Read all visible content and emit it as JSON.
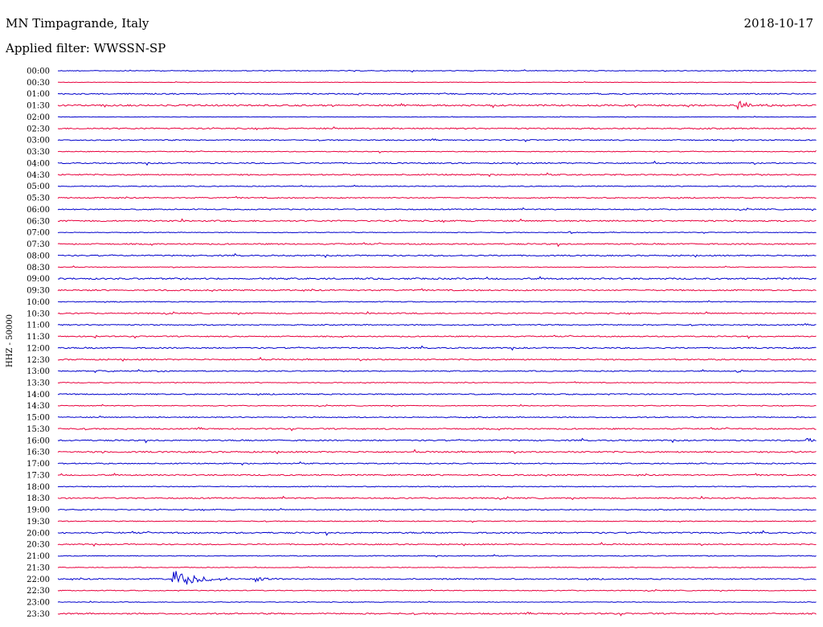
{
  "header": {
    "station": "MN Timpagrande, Italy",
    "date": "2018-10-17",
    "filter": "Applied filter: WWSSN-SP"
  },
  "chart_data": {
    "type": "line",
    "ylabel": "HHZ - 50000",
    "series_colors": [
      "#0000cc",
      "#e8003d"
    ],
    "row_times": [
      "00:00",
      "00:30",
      "01:00",
      "01:30",
      "02:00",
      "02:30",
      "03:00",
      "03:30",
      "04:00",
      "04:30",
      "05:00",
      "05:30",
      "06:00",
      "06:30",
      "07:00",
      "07:30",
      "08:00",
      "08:30",
      "09:00",
      "09:30",
      "10:00",
      "10:30",
      "11:00",
      "11:30",
      "12:00",
      "12:30",
      "13:00",
      "13:30",
      "14:00",
      "14:30",
      "15:00",
      "15:30",
      "16:00",
      "16:30",
      "17:00",
      "17:30",
      "18:00",
      "18:30",
      "19:00",
      "19:30",
      "20:00",
      "20:30",
      "21:00",
      "21:30",
      "22:00",
      "22:30",
      "23:00",
      "23:30"
    ],
    "row_noise": [
      0.9,
      0.5,
      1.4,
      1.8,
      0.6,
      1.5,
      1.3,
      0.9,
      1.4,
      1.5,
      1.0,
      1.3,
      1.3,
      1.7,
      0.8,
      1.5,
      1.4,
      0.8,
      1.8,
      1.5,
      1.0,
      1.4,
      1.3,
      1.3,
      1.5,
      1.5,
      1.2,
      0.9,
      1.4,
      1.0,
      1.2,
      1.5,
      1.5,
      1.7,
      1.3,
      1.5,
      1.0,
      1.5,
      1.2,
      1.0,
      1.6,
      1.3,
      1.0,
      0.8,
      1.5,
      1.0,
      0.8,
      1.6
    ],
    "events": [
      {
        "row": 3,
        "minute": 13.5,
        "amplitude": 2,
        "duration": 1.0
      },
      {
        "row": 3,
        "minute": 26.8,
        "amplitude": 8,
        "duration": 1.5
      },
      {
        "row": 10,
        "minute": 6.3,
        "amplitude": 2,
        "duration": 0.6
      },
      {
        "row": 14,
        "minute": 20.2,
        "amplitude": 2,
        "duration": 0.7
      },
      {
        "row": 23,
        "minute": 1.4,
        "amplitude": 3,
        "duration": 0.3
      },
      {
        "row": 24,
        "minute": 1.4,
        "amplitude": 2,
        "duration": 0.3
      },
      {
        "row": 26,
        "minute": 1.6,
        "amplitude": 1.5,
        "duration": 1.2
      },
      {
        "row": 26,
        "minute": 3.9,
        "amplitude": 2,
        "duration": 0.8
      },
      {
        "row": 26,
        "minute": 26.8,
        "amplitude": 2,
        "duration": 0.8
      },
      {
        "row": 32,
        "minute": 29.6,
        "amplitude": 4,
        "duration": 0.6
      },
      {
        "row": 33,
        "minute": 28.9,
        "amplitude": 2,
        "duration": 0.6
      },
      {
        "row": 40,
        "minute": 30.5,
        "amplitude": 2,
        "duration": 0.4
      },
      {
        "row": 44,
        "minute": 4.5,
        "amplitude": 15,
        "duration": 2.5
      },
      {
        "row": 44,
        "minute": 7.8,
        "amplitude": 5,
        "duration": 1.2
      }
    ]
  }
}
